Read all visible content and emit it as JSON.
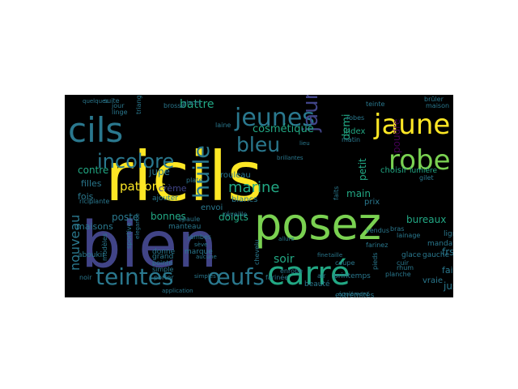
{
  "wordcloud": {
    "palette": {
      "yellow": "#fde725",
      "lightgreen": "#7ad151",
      "green": "#22a884",
      "teal": "#2a788e",
      "blue": "#414487",
      "purple": "#440154"
    },
    "words": [
      {
        "text": "ricils",
        "color": "yellow"
      },
      {
        "text": "bien",
        "color": "blue"
      },
      {
        "text": "posez",
        "color": "lightgreen"
      },
      {
        "text": "carré",
        "color": "green"
      },
      {
        "text": "cils",
        "color": "teal"
      },
      {
        "text": "jeunes",
        "color": "teal"
      },
      {
        "text": "jaune",
        "color": "yellow"
      },
      {
        "text": "robe",
        "color": "lightgreen"
      },
      {
        "text": "incolore",
        "color": "teal"
      },
      {
        "text": "bleu",
        "color": "teal"
      },
      {
        "text": "teintes",
        "color": "teal"
      },
      {
        "text": "œufs",
        "color": "teal"
      },
      {
        "text": "huile",
        "color": "teal"
      },
      {
        "text": "jaunes",
        "color": "blue"
      },
      {
        "text": "patrons",
        "color": "yellow"
      },
      {
        "text": "marine",
        "color": "green"
      },
      {
        "text": "nouveau",
        "color": "teal"
      },
      {
        "text": "battre",
        "color": "green"
      },
      {
        "text": "cosmétique",
        "color": "green"
      },
      {
        "text": "bonnes",
        "color": "green"
      },
      {
        "text": "doigts",
        "color": "green"
      },
      {
        "text": "soir",
        "color": "green"
      },
      {
        "text": "poste",
        "color": "teal"
      },
      {
        "text": "contre",
        "color": "green"
      },
      {
        "text": "filles",
        "color": "teal"
      },
      {
        "text": "maisons",
        "color": "teal"
      },
      {
        "text": "fois",
        "color": "teal"
      },
      {
        "text": "jupe",
        "color": "teal"
      },
      {
        "text": "crème",
        "color": "blue"
      },
      {
        "text": "demi",
        "color": "green"
      },
      {
        "text": "main",
        "color": "green"
      },
      {
        "text": "petit",
        "color": "green"
      },
      {
        "text": "poudre",
        "color": "purple"
      },
      {
        "text": "frs",
        "color": "teal"
      },
      {
        "text": "jus",
        "color": "teal"
      },
      {
        "text": "choisir",
        "color": "green"
      },
      {
        "text": "index",
        "color": "green"
      },
      {
        "text": "prix",
        "color": "teal"
      },
      {
        "text": "rouleau",
        "color": "teal"
      },
      {
        "text": "envoi",
        "color": "teal"
      },
      {
        "text": "blancs",
        "color": "teal"
      },
      {
        "text": "bureaux",
        "color": "green"
      },
      {
        "text": "faites",
        "color": "teal"
      },
      {
        "text": "vraie",
        "color": "teal"
      },
      {
        "text": "beauté",
        "color": "teal"
      },
      {
        "text": "extrémités",
        "color": "teal"
      },
      {
        "text": "printemps",
        "color": "teal"
      },
      {
        "text": "glace",
        "color": "teal"
      },
      {
        "text": "gauche",
        "color": "teal"
      },
      {
        "text": "ligne",
        "color": "teal"
      },
      {
        "text": "lumière",
        "color": "green"
      },
      {
        "text": "gilet",
        "color": "teal"
      },
      {
        "text": "robes",
        "color": "teal"
      },
      {
        "text": "matin",
        "color": "teal"
      },
      {
        "text": "ricin",
        "color": "teal"
      },
      {
        "text": "plante",
        "color": "teal"
      },
      {
        "text": "donne",
        "color": "teal"
      },
      {
        "text": "manteau",
        "color": "teal"
      },
      {
        "text": "grand",
        "color": "teal"
      },
      {
        "text": "pointe",
        "color": "teal"
      },
      {
        "text": "simple",
        "color": "teal"
      },
      {
        "text": "marque",
        "color": "teal"
      },
      {
        "text": "porter",
        "color": "teal"
      },
      {
        "text": "modèles",
        "color": "teal"
      },
      {
        "text": "sportive",
        "color": "teal"
      },
      {
        "text": "aboukir",
        "color": "teal"
      },
      {
        "text": "noir",
        "color": "teal"
      },
      {
        "text": "jour",
        "color": "teal"
      },
      {
        "text": "linge",
        "color": "teal"
      },
      {
        "text": "brosse",
        "color": "teal"
      },
      {
        "text": "suite",
        "color": "teal"
      },
      {
        "text": "jambes",
        "color": "teal"
      },
      {
        "text": "épaule",
        "color": "teal"
      },
      {
        "text": "laine",
        "color": "teal"
      },
      {
        "text": "triangle",
        "color": "teal"
      },
      {
        "text": "ajouter",
        "color": "teal"
      },
      {
        "text": "bras",
        "color": "teal"
      },
      {
        "text": "lainage",
        "color": "teal"
      },
      {
        "text": "mandat",
        "color": "teal"
      },
      {
        "text": "coupe",
        "color": "teal"
      },
      {
        "text": "planche",
        "color": "teal"
      },
      {
        "text": "farinez",
        "color": "teal"
      },
      {
        "text": "vendus",
        "color": "teal"
      },
      {
        "text": "faits",
        "color": "teal"
      },
      {
        "text": "brûler",
        "color": "teal"
      },
      {
        "text": "maison",
        "color": "teal"
      },
      {
        "text": "teinte",
        "color": "teal"
      },
      {
        "text": "application",
        "color": "teal"
      },
      {
        "text": "air",
        "color": "teal"
      },
      {
        "text": "cuir",
        "color": "teal"
      },
      {
        "text": "rhum",
        "color": "teal"
      },
      {
        "text": "enrobe",
        "color": "teal"
      },
      {
        "text": "réveille",
        "color": "teal"
      },
      {
        "text": "pieds",
        "color": "teal"
      },
      {
        "text": "places",
        "color": "teal"
      },
      {
        "text": "lieu",
        "color": "teal"
      },
      {
        "text": "elegance",
        "color": "teal"
      },
      {
        "text": "également",
        "color": "teal"
      },
      {
        "text": "simples",
        "color": "teal"
      },
      {
        "text": "sève",
        "color": "teal"
      },
      {
        "text": "aucune",
        "color": "teal"
      },
      {
        "text": "plate",
        "color": "teal"
      },
      {
        "text": "brillantes",
        "color": "teal"
      },
      {
        "text": "farinée",
        "color": "teal"
      },
      {
        "text": "chevelu",
        "color": "teal"
      },
      {
        "text": "allure",
        "color": "teal"
      },
      {
        "text": "fine",
        "color": "teal"
      },
      {
        "text": "taille",
        "color": "teal"
      },
      {
        "text": "quelques",
        "color": "teal"
      }
    ]
  }
}
